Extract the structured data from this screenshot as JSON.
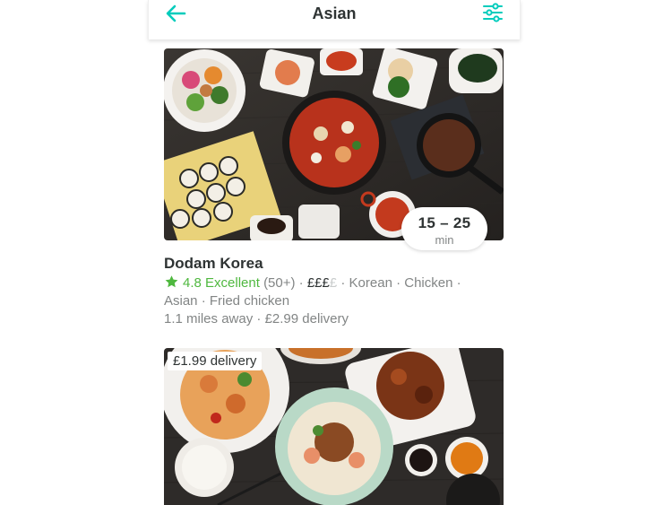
{
  "header": {
    "title": "Asian",
    "back_icon": "arrow-left-icon",
    "filter_icon": "sliders-icon",
    "accent_color": "#00ccbc"
  },
  "restaurants": [
    {
      "name": "Dodam Korea",
      "eta": {
        "range": "15 – 25",
        "unit": "min"
      },
      "rating": {
        "icon": "star-icon",
        "value": "4.8 Excellent",
        "count": "(50+)"
      },
      "price": {
        "active": "£££",
        "inactive": "£"
      },
      "tags_line1": "· Korean · Chicken ·",
      "tags_line2": "Asian · Fried chicken",
      "distance": "1.1 miles away",
      "delivery": "£2.99 delivery",
      "separator": "·"
    },
    {
      "delivery_badge": "£1.99 delivery"
    }
  ],
  "colors": {
    "rating_green": "#4fb83f",
    "text_dark": "#2e3333",
    "text_grey": "#828585"
  }
}
